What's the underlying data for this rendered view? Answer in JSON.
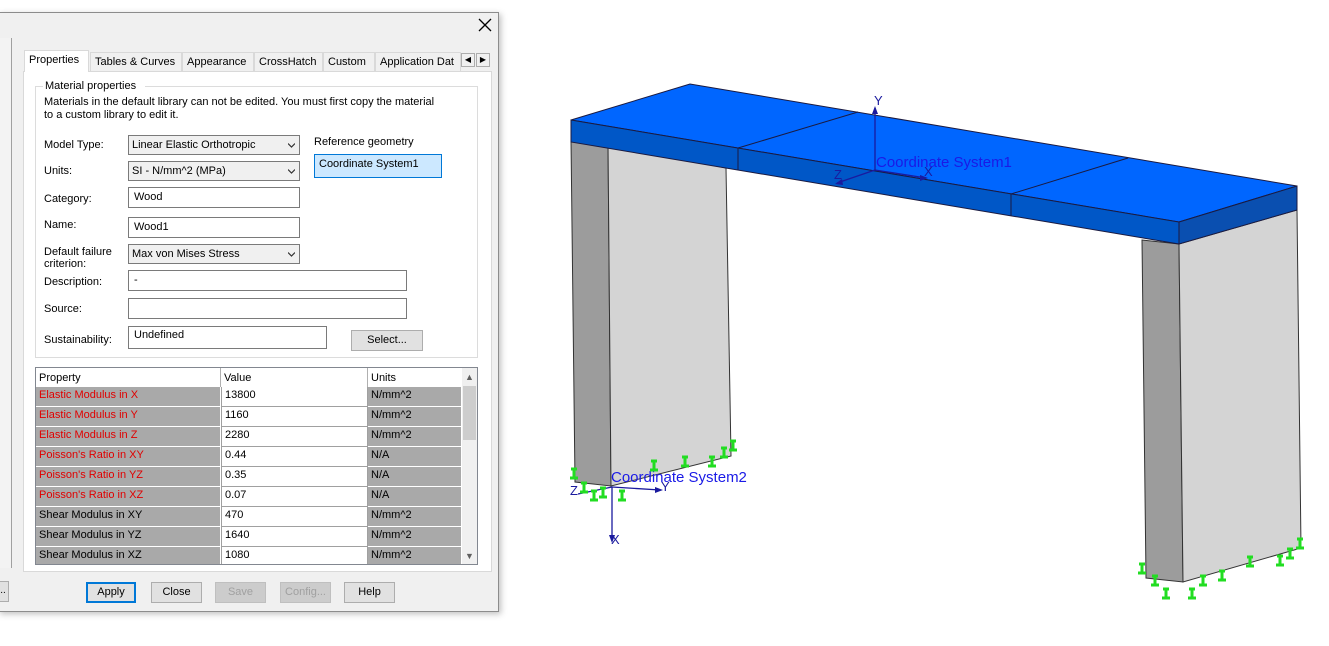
{
  "dialog": {
    "close_glyph": "✕",
    "left_button_label": "..",
    "tabs": [
      "Properties",
      "Tables & Curves",
      "Appearance",
      "CrossHatch",
      "Custom",
      "Application Dat"
    ],
    "group_title": "Material properties",
    "note_line1": "Materials in the default library can not be edited. You must first copy the material",
    "note_line2": "to a custom library to edit it.",
    "model_type": {
      "label": "Model Type:",
      "value": "Linear Elastic Orthotropic"
    },
    "units": {
      "label": "Units:",
      "value": "SI - N/mm^2 (MPa)"
    },
    "category": {
      "label": "Category:",
      "value": "Wood"
    },
    "name": {
      "label": "Name:",
      "value": "Wood1"
    },
    "failure": {
      "label_line1": "Default failure",
      "label_line2": "criterion:",
      "value": "Max von Mises Stress"
    },
    "description": {
      "label": "Description:",
      "value": "-"
    },
    "source": {
      "label": "Source:",
      "value": ""
    },
    "sustainability": {
      "label": "Sustainability:",
      "value": "Undefined"
    },
    "select_button": "Select...",
    "reference_geometry": {
      "label": "Reference geometry",
      "value": "Coordinate System1"
    },
    "grid": {
      "headers": [
        "Property",
        "Value",
        "Units"
      ],
      "rows": [
        {
          "property": "Elastic Modulus in X",
          "value": "13800",
          "units": "N/mm^2",
          "required": true
        },
        {
          "property": "Elastic Modulus in Y",
          "value": "1160",
          "units": "N/mm^2",
          "required": true
        },
        {
          "property": "Elastic Modulus in Z",
          "value": "2280",
          "units": "N/mm^2",
          "required": true
        },
        {
          "property": "Poisson's Ratio in XY",
          "value": "0.44",
          "units": "N/A",
          "required": true
        },
        {
          "property": "Poisson's Ratio in YZ",
          "value": "0.35",
          "units": "N/A",
          "required": true
        },
        {
          "property": "Poisson's Ratio in XZ",
          "value": "0.07",
          "units": "N/A",
          "required": true
        },
        {
          "property": "Shear Modulus in XY",
          "value": "470",
          "units": "N/mm^2",
          "required": false
        },
        {
          "property": "Shear Modulus in YZ",
          "value": "1640",
          "units": "N/mm^2",
          "required": false
        },
        {
          "property": "Shear Modulus in XZ",
          "value": "1080",
          "units": "N/mm^2",
          "required": false
        }
      ]
    },
    "buttons": {
      "apply": "Apply",
      "close": "Close",
      "save": "Save",
      "config": "Config...",
      "help": "Help"
    }
  },
  "viewport": {
    "cs1": {
      "label": "Coordinate System1",
      "axis_y": "Y",
      "axis_x": "X",
      "axis_z": "Z"
    },
    "cs2": {
      "label": "Coordinate System2",
      "axis_x": "X",
      "axis_y": "Y",
      "axis_z": "Z"
    },
    "colors": {
      "top_face": "#0066ff",
      "top_side": "#0057c7",
      "leg_front": "#d4d4d4",
      "leg_side": "#9c9c9c",
      "axis": "#1a1ae6",
      "fixture": "#22dd22"
    }
  }
}
